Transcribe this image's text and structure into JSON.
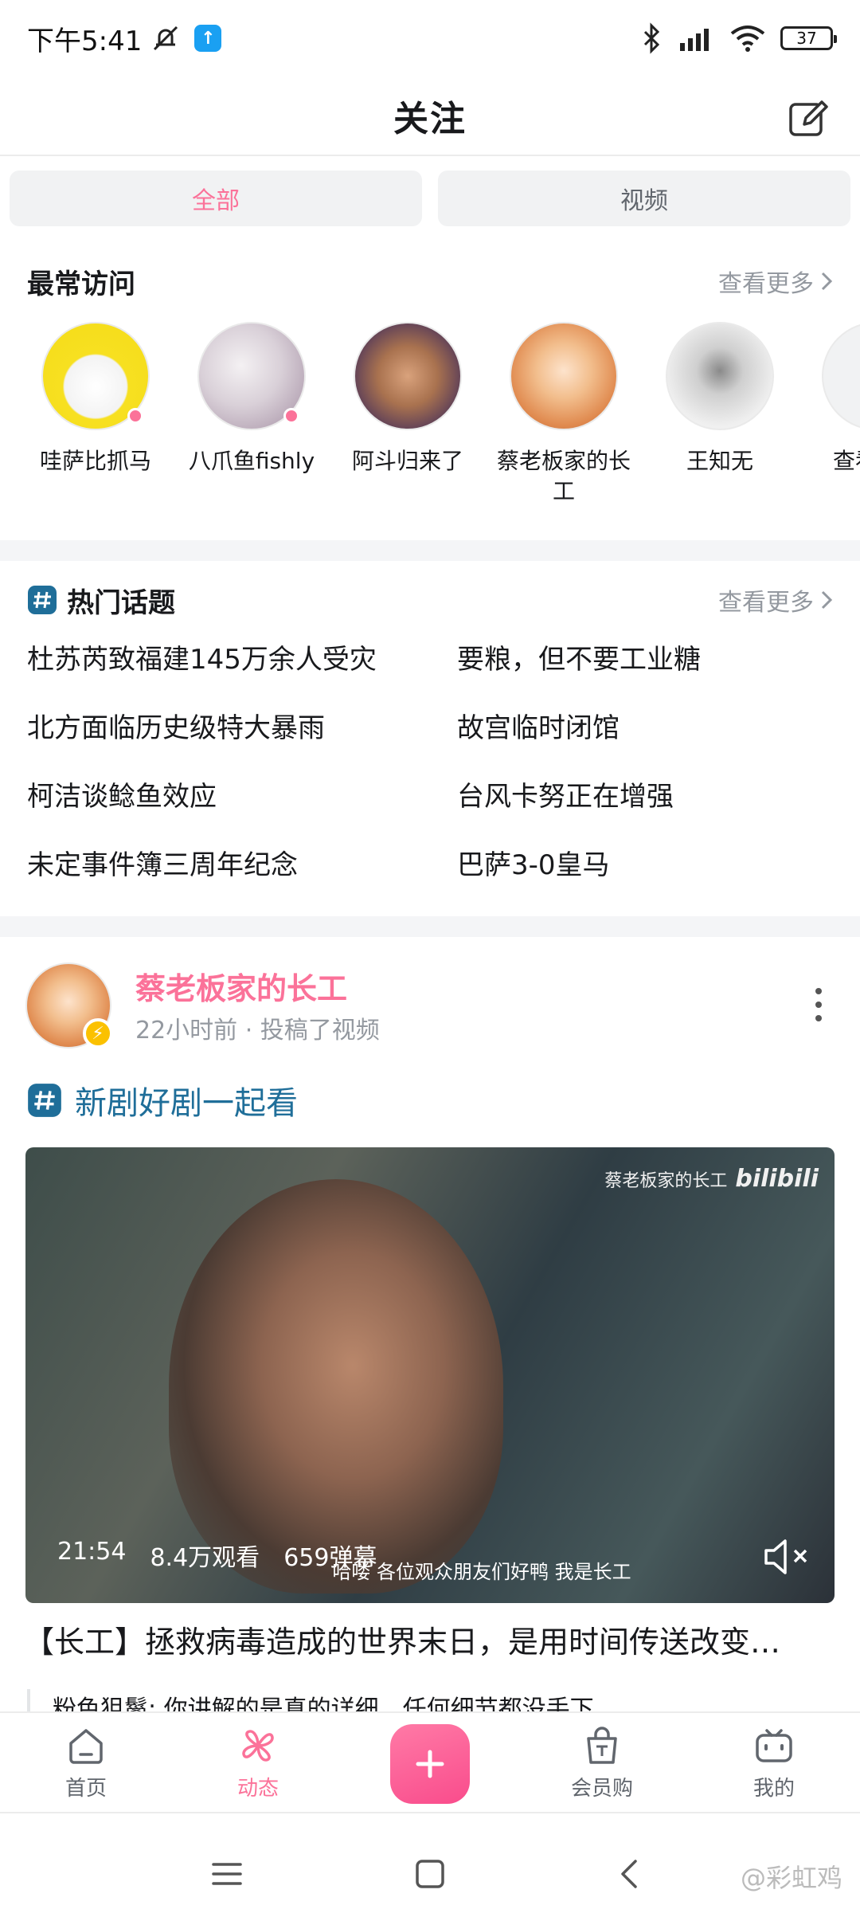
{
  "status_bar": {
    "time": "下午5:41",
    "battery": "37"
  },
  "header": {
    "title": "关注"
  },
  "filter_tabs": [
    {
      "label": "全部",
      "active": true
    },
    {
      "label": "视频",
      "active": false
    }
  ],
  "frequent": {
    "title": "最常访问",
    "see_more": "查看更多",
    "users": [
      {
        "name": "哇萨比抓马",
        "live": true
      },
      {
        "name": "八爪鱼fishly",
        "live": true
      },
      {
        "name": "阿斗归来了",
        "live": false
      },
      {
        "name": "蔡老板家的长工",
        "live": false
      },
      {
        "name": "王知无",
        "live": false
      },
      {
        "name": "查看",
        "live": false
      }
    ]
  },
  "hot_topics": {
    "title": "热门话题",
    "see_more": "查看更多",
    "items": [
      "杜苏芮致福建145万余人受灾",
      "要粮，但不要工业糖",
      "北方面临历史级特大暴雨",
      "故宫临时闭馆",
      "柯洁谈鲶鱼效应",
      "台风卡努正在增强",
      "未定事件簿三周年纪念",
      "巴萨3-0皇马"
    ]
  },
  "post": {
    "author": "蔡老板家的长工",
    "meta": "22小时前 · 投稿了视频",
    "topic": "新剧好剧一起看",
    "video": {
      "duration": "21:54",
      "views": "8.4万观看",
      "danmaku": "659弹幕",
      "subtitle": "哈喽 各位观众朋友们好鸭 我是长工",
      "watermark_name": "蔡老板家的长工",
      "watermark_logo": "bilibili"
    },
    "title": "【长工】拯救病毒造成的世界末日，是用时间传送改变…",
    "comment": "粉色狙鬣: 你讲解的是真的详细，任何细节都没手下"
  },
  "bottom_nav": {
    "items": [
      {
        "label": "首页",
        "icon": "home-icon",
        "active": false
      },
      {
        "label": "动态",
        "icon": "pinwheel-icon",
        "active": true
      },
      {
        "label": "会员购",
        "icon": "shopping-bag-icon",
        "active": false
      },
      {
        "label": "我的",
        "icon": "tv-icon",
        "active": false
      }
    ]
  },
  "watermark": "@彩虹鸡",
  "colors": {
    "accent": "#fb7299",
    "topic_blue": "#1f6e99",
    "muted": "#9499a0"
  }
}
